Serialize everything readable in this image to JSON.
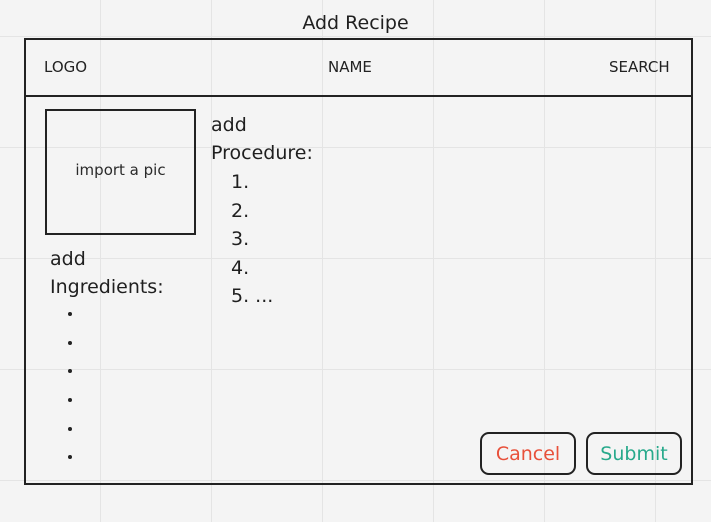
{
  "page_title": "Add Recipe",
  "header": {
    "logo": "LOGO",
    "name": "NAME",
    "search": "SEARCH"
  },
  "picture": {
    "label": "import a pic"
  },
  "procedure": {
    "heading_line1": "add",
    "heading_line2": "Procedure:",
    "items": [
      "1.",
      "2.",
      "3.",
      "4.",
      "5. ..."
    ]
  },
  "ingredients": {
    "heading_line1": "add",
    "heading_line2": "Ingredients:",
    "bullet_count": 6
  },
  "actions": {
    "cancel_label": "Cancel",
    "submit_label": "Submit"
  },
  "colors": {
    "cancel": "#e8503a",
    "submit": "#27a98b"
  }
}
